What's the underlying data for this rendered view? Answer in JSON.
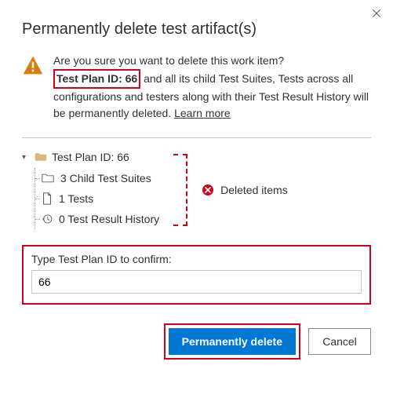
{
  "dialog": {
    "title": "Permanently delete test artifact(s)",
    "close_aria": "Close"
  },
  "message": {
    "line_before_id": "Are you sure you want to delete this work item?",
    "test_plan_id_label": "Test Plan ID: 66",
    "line_after_id": "and all its child Test Suites, Tests across all configurations and testers along with their Test Result History will be permanently deleted.",
    "learn_more": "Learn more"
  },
  "tree": {
    "root_label": "Test Plan ID: 66",
    "items": [
      {
        "label": "3 Child Test Suites"
      },
      {
        "label": "1 Tests"
      },
      {
        "label": "0 Test Result History"
      }
    ]
  },
  "deleted_items_label": "Deleted items",
  "confirm": {
    "label": "Type Test Plan ID to confirm:",
    "value": "66"
  },
  "buttons": {
    "primary": "Permanently delete",
    "secondary": "Cancel"
  }
}
